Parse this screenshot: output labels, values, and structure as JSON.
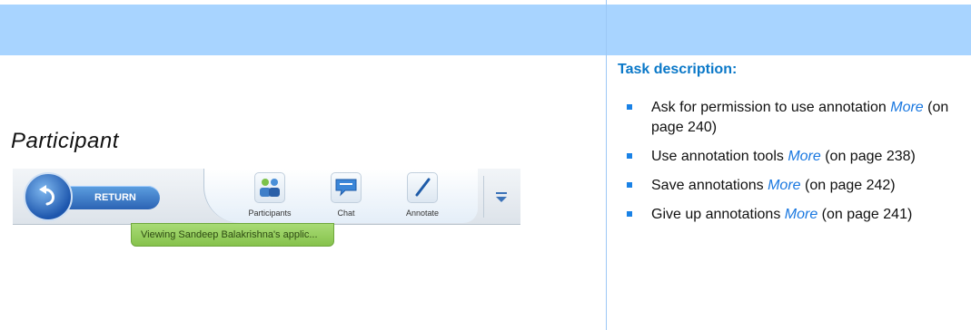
{
  "task_description": {
    "heading": "Task description:",
    "items": [
      {
        "text_before": "Ask for permission to use annotation ",
        "more": "More",
        "text_after": " (on page 240)"
      },
      {
        "text_before": "Use annotation tools ",
        "more": "More",
        "text_after": " (on page 238)"
      },
      {
        "text_before": "Save annotations ",
        "more": "More",
        "text_after": " (on page 242)"
      },
      {
        "text_before": "Give up annotations ",
        "more": "More",
        "text_after": " (on page 241)"
      }
    ]
  },
  "participant_label": "Participant",
  "toolbar": {
    "return_label": "RETURN",
    "tools": [
      {
        "label": "Participants",
        "icon": "participants-icon"
      },
      {
        "label": "Chat",
        "icon": "chat-bubble-icon"
      },
      {
        "label": "Annotate",
        "icon": "pen-icon"
      }
    ],
    "menu_icon": "menu-chevron-icon",
    "status_text": "Viewing Sandeep Balakrishna's applic..."
  },
  "colors": {
    "header_band": "#a8d4ff",
    "heading_blue": "#0a78c8",
    "link_blue": "#1a78e0",
    "bullet_blue": "#1a82e6",
    "status_green": "#94cc5e"
  }
}
